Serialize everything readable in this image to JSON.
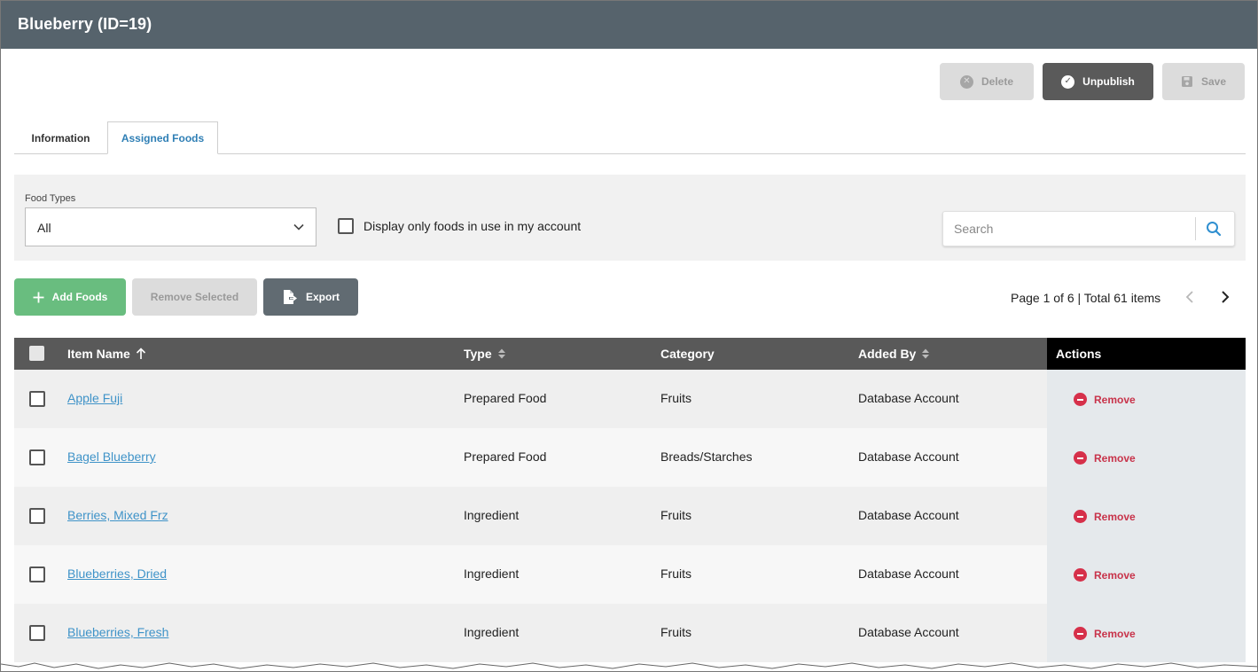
{
  "window": {
    "title": "Blueberry (ID=19)"
  },
  "toolbar": {
    "delete_label": "Delete",
    "unpublish_label": "Unpublish",
    "save_label": "Save"
  },
  "tabs": [
    {
      "label": "Information",
      "active": false
    },
    {
      "label": "Assigned Foods",
      "active": true
    }
  ],
  "filters": {
    "food_types_label": "Food Types",
    "food_types_value": "All",
    "display_in_use_label": "Display only foods in use in my account",
    "display_in_use_checked": false,
    "search_placeholder": "Search"
  },
  "actions": {
    "add_foods_label": "Add Foods",
    "remove_selected_label": "Remove Selected",
    "export_label": "Export"
  },
  "pager": {
    "text": "Page 1 of 6 | Total 61 items"
  },
  "table": {
    "columns": {
      "item_name": "Item Name",
      "type": "Type",
      "category": "Category",
      "added_by": "Added By",
      "actions": "Actions"
    },
    "remove_label": "Remove",
    "rows": [
      {
        "name": "Apple Fuji",
        "type": "Prepared Food",
        "category": "Fruits",
        "added_by": "Database Account"
      },
      {
        "name": "Bagel Blueberry",
        "type": "Prepared Food",
        "category": "Breads/Starches",
        "added_by": "Database Account"
      },
      {
        "name": "Berries, Mixed Frz",
        "type": "Ingredient",
        "category": "Fruits",
        "added_by": "Database Account"
      },
      {
        "name": "Blueberries, Dried",
        "type": "Ingredient",
        "category": "Fruits",
        "added_by": "Database Account"
      },
      {
        "name": "Blueberries, Fresh",
        "type": "Ingredient",
        "category": "Fruits",
        "added_by": "Database Account"
      }
    ]
  },
  "colors": {
    "header_bg": "#56636c",
    "accent_link": "#3f93c8",
    "add_green": "#69bd7f",
    "remove_red": "#d6304a"
  }
}
